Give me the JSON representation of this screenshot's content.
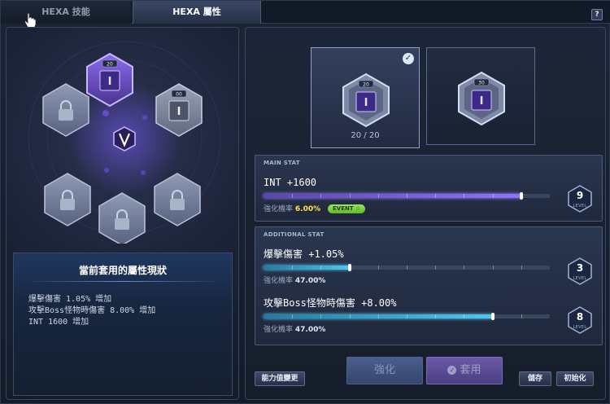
{
  "tabs": [
    {
      "label": "HEXA 技能",
      "active": false
    },
    {
      "label": "HEXA 屬性",
      "active": true
    }
  ],
  "help_label": "?",
  "hex_board": {
    "slots": [
      {
        "state": "equipped",
        "level_badge": "20"
      },
      {
        "state": "equipped",
        "level_badge": "00"
      },
      {
        "state": "locked"
      },
      {
        "state": "locked"
      },
      {
        "state": "locked"
      },
      {
        "state": "locked"
      }
    ],
    "center_icon": "v-emblem-icon"
  },
  "status": {
    "title": "當前套用的屬性現狀",
    "lines": [
      "爆擊傷害 1.05% 增加",
      "攻擊Boss怪物時傷害 8.00% 增加",
      "INT 1600 增加"
    ]
  },
  "cores": [
    {
      "badge": "20",
      "count_text": "20 / 20",
      "selected": true
    },
    {
      "badge": "30",
      "selected": false
    }
  ],
  "main_stat": {
    "section_label": "MAIN STAT",
    "name": "INT +1600",
    "rate_label": "強化機率",
    "rate_value": "6.00%",
    "event_badge": "EVENT ☆",
    "level": "9",
    "level_word": "LEVEL",
    "progress": 0.9
  },
  "additional_stat": {
    "section_label": "ADDITIONAL STAT",
    "stats": [
      {
        "name": "爆擊傷害 +1.05%",
        "rate_label": "強化機率",
        "rate_value": "47.00%",
        "level": "3",
        "level_word": "LEVEL",
        "progress": 0.3
      },
      {
        "name": "攻擊Boss怪物時傷害 +8.00%",
        "rate_label": "強化機率",
        "rate_value": "47.00%",
        "level": "8",
        "level_word": "LEVEL",
        "progress": 0.8
      }
    ]
  },
  "buttons": {
    "stat_change": "能力值變更",
    "enhance": "強化",
    "apply": "套用",
    "save": "儲存",
    "reset": "初始化"
  },
  "colors": {
    "main_bar": "#8c74ff",
    "additional_bar": "#4ec8ee",
    "rate_highlight": "#ffe14d"
  }
}
